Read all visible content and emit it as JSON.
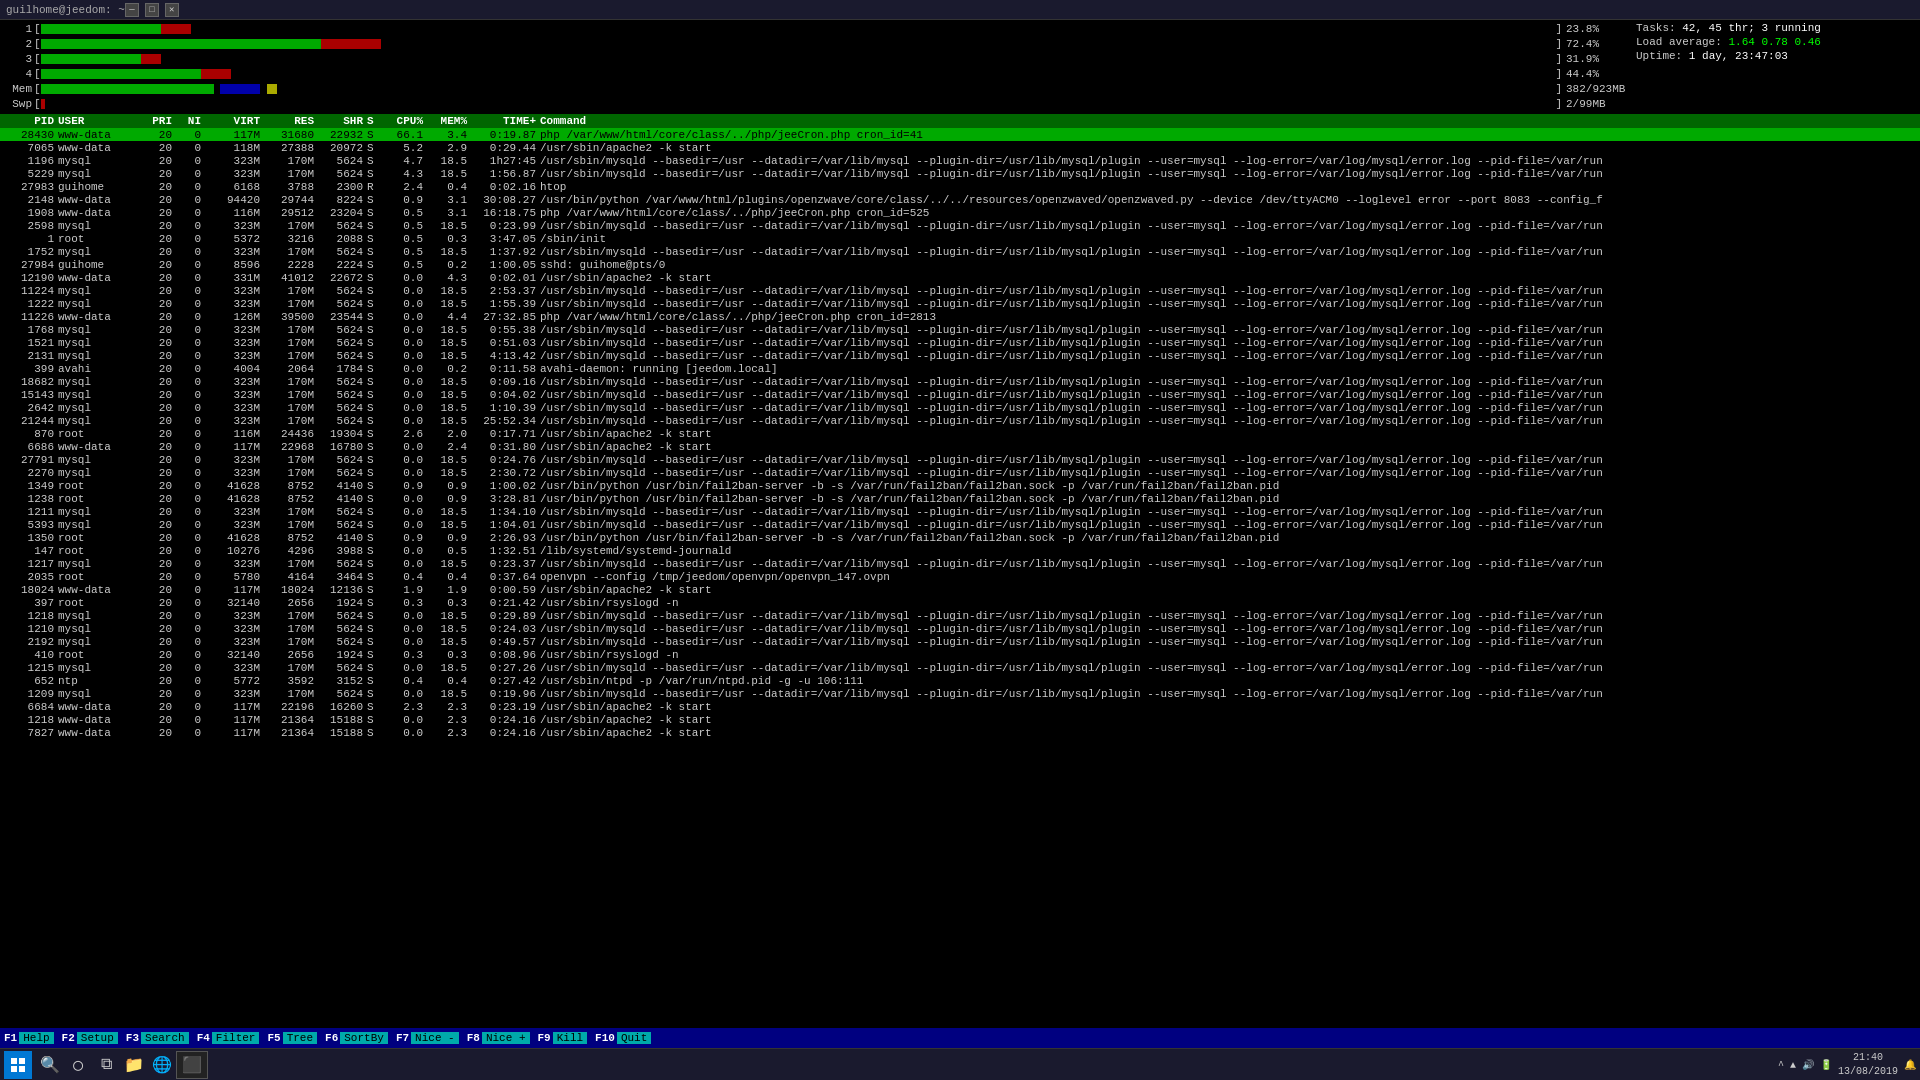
{
  "titlebar": {
    "title": "guilhome@jeedom: ~",
    "controls": [
      "—",
      "□",
      "✕"
    ]
  },
  "cpu_bars": [
    {
      "label": "1",
      "percent": "23.8%",
      "green_w": 120,
      "red_w": 30,
      "total_w": 420
    },
    {
      "label": "2",
      "percent": "72.4%",
      "green_w": 280,
      "red_w": 60,
      "total_w": 420
    },
    {
      "label": "3",
      "percent": "31.9%",
      "green_w": 100,
      "red_w": 20,
      "total_w": 420
    },
    {
      "label": "4",
      "percent": "44.4%",
      "green_w": 160,
      "red_w": 30,
      "total_w": 420
    }
  ],
  "mem_bar": {
    "label": "Mem",
    "used": "382",
    "total": "923MB",
    "display": "382/923MB",
    "green_w": 173,
    "blue_w": 40,
    "yellow_w": 10,
    "total_w": 420
  },
  "swap_bar": {
    "label": "Swp",
    "used": "2",
    "total": "99MB",
    "display": "2/99MB",
    "green_w": 4,
    "total_w": 420
  },
  "sysinfo": {
    "tasks_label": "Tasks:",
    "tasks_val": "42, 45 thr; 3 running",
    "load_label": "Load average:",
    "load_val": "1.64 0.78 0.46",
    "uptime_label": "Uptime:",
    "uptime_val": "1 day, 23:47:03"
  },
  "proc_header": {
    "pid": "PID",
    "user": "USER",
    "pri": "PRI",
    "ni": "NI",
    "virt": "VIRT",
    "res": "RES",
    "shr": "SHR",
    "s": "S",
    "cpu": "CPU%",
    "mem": "MEM%",
    "time": "TIME+",
    "cmd": "Command"
  },
  "processes": [
    {
      "pid": "28430",
      "user": "www-data",
      "pri": "20",
      "ni": "0",
      "virt": "117M",
      "res": "31680",
      "shr": "22932",
      "s": "S",
      "cpu": "66.1",
      "mem": "3.4",
      "time": "0:19.87",
      "cmd": "php /var/www/html/core/class/../php/jeeCron.php cron_id=41",
      "highlight": true
    },
    {
      "pid": "7065",
      "user": "www-data",
      "pri": "20",
      "ni": "0",
      "virt": "118M",
      "res": "27388",
      "shr": "20972",
      "s": "S",
      "cpu": "5.2",
      "mem": "2.9",
      "time": "0:29.44",
      "cmd": "/usr/sbin/apache2 -k start"
    },
    {
      "pid": "1196",
      "user": "mysql",
      "pri": "20",
      "ni": "0",
      "virt": "323M",
      "res": "170M",
      "shr": "5624",
      "s": "S",
      "cpu": "4.7",
      "mem": "18.5",
      "time": "1h27:45",
      "cmd": "/usr/sbin/mysqld --basedir=/usr --datadir=/var/lib/mysql --plugin-dir=/usr/lib/mysql/plugin --user=mysql --log-error=/var/log/mysql/error.log --pid-file=/var/run"
    },
    {
      "pid": "5229",
      "user": "mysql",
      "pri": "20",
      "ni": "0",
      "virt": "323M",
      "res": "170M",
      "shr": "5624",
      "s": "S",
      "cpu": "4.3",
      "mem": "18.5",
      "time": "1:56.87",
      "cmd": "/usr/sbin/mysqld --basedir=/usr --datadir=/var/lib/mysql --plugin-dir=/usr/lib/mysql/plugin --user=mysql --log-error=/var/log/mysql/error.log --pid-file=/var/run"
    },
    {
      "pid": "27983",
      "user": "guihome",
      "pri": "20",
      "ni": "0",
      "virt": "6168",
      "res": "3788",
      "shr": "2300",
      "s": "R",
      "cpu": "2.4",
      "mem": "0.4",
      "time": "0:02.16",
      "cmd": "htop"
    },
    {
      "pid": "2148",
      "user": "www-data",
      "pri": "20",
      "ni": "0",
      "virt": "94420",
      "res": "29744",
      "shr": "8224",
      "s": "S",
      "cpu": "0.9",
      "mem": "3.1",
      "time": "30:08.27",
      "cmd": "/usr/bin/python /var/www/html/plugins/openzwave/core/class/../../resources/openzwaved/openzwaved.py --device /dev/ttyACM0 --loglevel error --port 8083 --config_f"
    },
    {
      "pid": "1908",
      "user": "www-data",
      "pri": "20",
      "ni": "0",
      "virt": "116M",
      "res": "29512",
      "shr": "23204",
      "s": "S",
      "cpu": "0.5",
      "mem": "3.1",
      "time": "16:18.75",
      "cmd": "php /var/www/html/core/class/../php/jeeCron.php cron_id=525"
    },
    {
      "pid": "2598",
      "user": "mysql",
      "pri": "20",
      "ni": "0",
      "virt": "323M",
      "res": "170M",
      "shr": "5624",
      "s": "S",
      "cpu": "0.5",
      "mem": "18.5",
      "time": "0:23.99",
      "cmd": "/usr/sbin/mysqld --basedir=/usr --datadir=/var/lib/mysql --plugin-dir=/usr/lib/mysql/plugin --user=mysql --log-error=/var/log/mysql/error.log --pid-file=/var/run"
    },
    {
      "pid": "1",
      "user": "root",
      "pri": "20",
      "ni": "0",
      "virt": "5372",
      "res": "3216",
      "shr": "2088",
      "s": "S",
      "cpu": "0.5",
      "mem": "0.3",
      "time": "3:47.05",
      "cmd": "/sbin/init"
    },
    {
      "pid": "1752",
      "user": "mysql",
      "pri": "20",
      "ni": "0",
      "virt": "323M",
      "res": "170M",
      "shr": "5624",
      "s": "S",
      "cpu": "0.5",
      "mem": "18.5",
      "time": "1:37.92",
      "cmd": "/usr/sbin/mysqld --basedir=/usr --datadir=/var/lib/mysql --plugin-dir=/usr/lib/mysql/plugin --user=mysql --log-error=/var/log/mysql/error.log --pid-file=/var/run"
    },
    {
      "pid": "27984",
      "user": "guihome",
      "pri": "20",
      "ni": "0",
      "virt": "8596",
      "res": "2228",
      "shr": "2224",
      "s": "S",
      "cpu": "0.5",
      "mem": "0.2",
      "time": "1:00.05",
      "cmd": "sshd: guihome@pts/0"
    },
    {
      "pid": "12190",
      "user": "www-data",
      "pri": "20",
      "ni": "0",
      "virt": "331M",
      "res": "41012",
      "shr": "22672",
      "s": "S",
      "cpu": "0.0",
      "mem": "4.3",
      "time": "0:02.01",
      "cmd": "/usr/sbin/apache2 -k start"
    },
    {
      "pid": "11224",
      "user": "mysql",
      "pri": "20",
      "ni": "0",
      "virt": "323M",
      "res": "170M",
      "shr": "5624",
      "s": "S",
      "cpu": "0.0",
      "mem": "18.5",
      "time": "2:53.37",
      "cmd": "/usr/sbin/mysqld --basedir=/usr --datadir=/var/lib/mysql --plugin-dir=/usr/lib/mysql/plugin --user=mysql --log-error=/var/log/mysql/error.log --pid-file=/var/run"
    },
    {
      "pid": "1222",
      "user": "mysql",
      "pri": "20",
      "ni": "0",
      "virt": "323M",
      "res": "170M",
      "shr": "5624",
      "s": "S",
      "cpu": "0.0",
      "mem": "18.5",
      "time": "1:55.39",
      "cmd": "/usr/sbin/mysqld --basedir=/usr --datadir=/var/lib/mysql --plugin-dir=/usr/lib/mysql/plugin --user=mysql --log-error=/var/log/mysql/error.log --pid-file=/var/run"
    },
    {
      "pid": "11226",
      "user": "www-data",
      "pri": "20",
      "ni": "0",
      "virt": "126M",
      "res": "39500",
      "shr": "23544",
      "s": "S",
      "cpu": "0.0",
      "mem": "4.4",
      "time": "27:32.85",
      "cmd": "php /var/www/html/core/class/../php/jeeCron.php cron_id=2813"
    },
    {
      "pid": "1768",
      "user": "mysql",
      "pri": "20",
      "ni": "0",
      "virt": "323M",
      "res": "170M",
      "shr": "5624",
      "s": "S",
      "cpu": "0.0",
      "mem": "18.5",
      "time": "0:55.38",
      "cmd": "/usr/sbin/mysqld --basedir=/usr --datadir=/var/lib/mysql --plugin-dir=/usr/lib/mysql/plugin --user=mysql --log-error=/var/log/mysql/error.log --pid-file=/var/run"
    },
    {
      "pid": "1521",
      "user": "mysql",
      "pri": "20",
      "ni": "0",
      "virt": "323M",
      "res": "170M",
      "shr": "5624",
      "s": "S",
      "cpu": "0.0",
      "mem": "18.5",
      "time": "0:51.03",
      "cmd": "/usr/sbin/mysqld --basedir=/usr --datadir=/var/lib/mysql --plugin-dir=/usr/lib/mysql/plugin --user=mysql --log-error=/var/log/mysql/error.log --pid-file=/var/run"
    },
    {
      "pid": "2131",
      "user": "mysql",
      "pri": "20",
      "ni": "0",
      "virt": "323M",
      "res": "170M",
      "shr": "5624",
      "s": "S",
      "cpu": "0.0",
      "mem": "18.5",
      "time": "4:13.42",
      "cmd": "/usr/sbin/mysqld --basedir=/usr --datadir=/var/lib/mysql --plugin-dir=/usr/lib/mysql/plugin --user=mysql --log-error=/var/log/mysql/error.log --pid-file=/var/run"
    },
    {
      "pid": "399",
      "user": "avahi",
      "pri": "20",
      "ni": "0",
      "virt": "4004",
      "res": "2064",
      "shr": "1784",
      "s": "S",
      "cpu": "0.0",
      "mem": "0.2",
      "time": "0:11.58",
      "cmd": "avahi-daemon: running [jeedom.local]"
    },
    {
      "pid": "18682",
      "user": "mysql",
      "pri": "20",
      "ni": "0",
      "virt": "323M",
      "res": "170M",
      "shr": "5624",
      "s": "S",
      "cpu": "0.0",
      "mem": "18.5",
      "time": "0:09.16",
      "cmd": "/usr/sbin/mysqld --basedir=/usr --datadir=/var/lib/mysql --plugin-dir=/usr/lib/mysql/plugin --user=mysql --log-error=/var/log/mysql/error.log --pid-file=/var/run"
    },
    {
      "pid": "15143",
      "user": "mysql",
      "pri": "20",
      "ni": "0",
      "virt": "323M",
      "res": "170M",
      "shr": "5624",
      "s": "S",
      "cpu": "0.0",
      "mem": "18.5",
      "time": "0:04.02",
      "cmd": "/usr/sbin/mysqld --basedir=/usr --datadir=/var/lib/mysql --plugin-dir=/usr/lib/mysql/plugin --user=mysql --log-error=/var/log/mysql/error.log --pid-file=/var/run"
    },
    {
      "pid": "2642",
      "user": "mysql",
      "pri": "20",
      "ni": "0",
      "virt": "323M",
      "res": "170M",
      "shr": "5624",
      "s": "S",
      "cpu": "0.0",
      "mem": "18.5",
      "time": "1:10.39",
      "cmd": "/usr/sbin/mysqld --basedir=/usr --datadir=/var/lib/mysql --plugin-dir=/usr/lib/mysql/plugin --user=mysql --log-error=/var/log/mysql/error.log --pid-file=/var/run"
    },
    {
      "pid": "21244",
      "user": "mysql",
      "pri": "20",
      "ni": "0",
      "virt": "323M",
      "res": "170M",
      "shr": "5624",
      "s": "S",
      "cpu": "0.0",
      "mem": "18.5",
      "time": "25:52.34",
      "cmd": "/usr/sbin/mysqld --basedir=/usr --datadir=/var/lib/mysql --plugin-dir=/usr/lib/mysql/plugin --user=mysql --log-error=/var/log/mysql/error.log --pid-file=/var/run"
    },
    {
      "pid": "870",
      "user": "root",
      "pri": "20",
      "ni": "0",
      "virt": "116M",
      "res": "24436",
      "shr": "19304",
      "s": "S",
      "cpu": "2.6",
      "mem": "2.0",
      "time": "0:17.71",
      "cmd": "/usr/sbin/apache2 -k start"
    },
    {
      "pid": "6686",
      "user": "www-data",
      "pri": "20",
      "ni": "0",
      "virt": "117M",
      "res": "22968",
      "shr": "16780",
      "s": "S",
      "cpu": "0.0",
      "mem": "2.4",
      "time": "0:31.80",
      "cmd": "/usr/sbin/apache2 -k start"
    },
    {
      "pid": "27791",
      "user": "mysql",
      "pri": "20",
      "ni": "0",
      "virt": "323M",
      "res": "170M",
      "shr": "5624",
      "s": "S",
      "cpu": "0.0",
      "mem": "18.5",
      "time": "0:24.76",
      "cmd": "/usr/sbin/mysqld --basedir=/usr --datadir=/var/lib/mysql --plugin-dir=/usr/lib/mysql/plugin --user=mysql --log-error=/var/log/mysql/error.log --pid-file=/var/run"
    },
    {
      "pid": "2270",
      "user": "mysql",
      "pri": "20",
      "ni": "0",
      "virt": "323M",
      "res": "170M",
      "shr": "5624",
      "s": "S",
      "cpu": "0.0",
      "mem": "18.5",
      "time": "2:30.72",
      "cmd": "/usr/sbin/mysqld --basedir=/usr --datadir=/var/lib/mysql --plugin-dir=/usr/lib/mysql/plugin --user=mysql --log-error=/var/log/mysql/error.log --pid-file=/var/run"
    },
    {
      "pid": "1349",
      "user": "root",
      "pri": "20",
      "ni": "0",
      "virt": "41628",
      "res": "8752",
      "shr": "4140",
      "s": "S",
      "cpu": "0.9",
      "mem": "0.9",
      "time": "1:00.02",
      "cmd": "/usr/bin/python /usr/bin/fail2ban-server -b -s /var/run/fail2ban/fail2ban.sock -p /var/run/fail2ban/fail2ban.pid"
    },
    {
      "pid": "1238",
      "user": "root",
      "pri": "20",
      "ni": "0",
      "virt": "41628",
      "res": "8752",
      "shr": "4140",
      "s": "S",
      "cpu": "0.0",
      "mem": "0.9",
      "time": "3:28.81",
      "cmd": "/usr/bin/python /usr/bin/fail2ban-server -b -s /var/run/fail2ban/fail2ban.sock -p /var/run/fail2ban/fail2ban.pid"
    },
    {
      "pid": "1211",
      "user": "mysql",
      "pri": "20",
      "ni": "0",
      "virt": "323M",
      "res": "170M",
      "shr": "5624",
      "s": "S",
      "cpu": "0.0",
      "mem": "18.5",
      "time": "1:34.10",
      "cmd": "/usr/sbin/mysqld --basedir=/usr --datadir=/var/lib/mysql --plugin-dir=/usr/lib/mysql/plugin --user=mysql --log-error=/var/log/mysql/error.log --pid-file=/var/run"
    },
    {
      "pid": "5393",
      "user": "mysql",
      "pri": "20",
      "ni": "0",
      "virt": "323M",
      "res": "170M",
      "shr": "5624",
      "s": "S",
      "cpu": "0.0",
      "mem": "18.5",
      "time": "1:04.01",
      "cmd": "/usr/sbin/mysqld --basedir=/usr --datadir=/var/lib/mysql --plugin-dir=/usr/lib/mysql/plugin --user=mysql --log-error=/var/log/mysql/error.log --pid-file=/var/run"
    },
    {
      "pid": "1350",
      "user": "root",
      "pri": "20",
      "ni": "0",
      "virt": "41628",
      "res": "8752",
      "shr": "4140",
      "s": "S",
      "cpu": "0.9",
      "mem": "0.9",
      "time": "2:26.93",
      "cmd": "/usr/bin/python /usr/bin/fail2ban-server -b -s /var/run/fail2ban/fail2ban.sock -p /var/run/fail2ban/fail2ban.pid"
    },
    {
      "pid": "147",
      "user": "root",
      "pri": "20",
      "ni": "0",
      "virt": "10276",
      "res": "4296",
      "shr": "3988",
      "s": "S",
      "cpu": "0.0",
      "mem": "0.5",
      "time": "1:32.51",
      "cmd": "/lib/systemd/systemd-journald"
    },
    {
      "pid": "1217",
      "user": "mysql",
      "pri": "20",
      "ni": "0",
      "virt": "323M",
      "res": "170M",
      "shr": "5624",
      "s": "S",
      "cpu": "0.0",
      "mem": "18.5",
      "time": "0:23.37",
      "cmd": "/usr/sbin/mysqld --basedir=/usr --datadir=/var/lib/mysql --plugin-dir=/usr/lib/mysql/plugin --user=mysql --log-error=/var/log/mysql/error.log --pid-file=/var/run"
    },
    {
      "pid": "2035",
      "user": "root",
      "pri": "20",
      "ni": "0",
      "virt": "5780",
      "res": "4164",
      "shr": "3464",
      "s": "S",
      "cpu": "0.4",
      "mem": "0.4",
      "time": "0:37.64",
      "cmd": "openvpn --config /tmp/jeedom/openvpn/openvpn_147.ovpn"
    },
    {
      "pid": "18024",
      "user": "www-data",
      "pri": "20",
      "ni": "0",
      "virt": "117M",
      "res": "18024",
      "shr": "12136",
      "s": "S",
      "cpu": "1.9",
      "mem": "1.9",
      "time": "0:00.59",
      "cmd": "/usr/sbin/apache2 -k start"
    },
    {
      "pid": "397",
      "user": "root",
      "pri": "20",
      "ni": "0",
      "virt": "32140",
      "res": "2656",
      "shr": "1924",
      "s": "S",
      "cpu": "0.3",
      "mem": "0.3",
      "time": "0:21.42",
      "cmd": "/usr/sbin/rsyslogd -n"
    },
    {
      "pid": "1218",
      "user": "mysql",
      "pri": "20",
      "ni": "0",
      "virt": "323M",
      "res": "170M",
      "shr": "5624",
      "s": "S",
      "cpu": "0.0",
      "mem": "18.5",
      "time": "0:29.89",
      "cmd": "/usr/sbin/mysqld --basedir=/usr --datadir=/var/lib/mysql --plugin-dir=/usr/lib/mysql/plugin --user=mysql --log-error=/var/log/mysql/error.log --pid-file=/var/run"
    },
    {
      "pid": "1210",
      "user": "mysql",
      "pri": "20",
      "ni": "0",
      "virt": "323M",
      "res": "170M",
      "shr": "5624",
      "s": "S",
      "cpu": "0.0",
      "mem": "18.5",
      "time": "0:24.03",
      "cmd": "/usr/sbin/mysqld --basedir=/usr --datadir=/var/lib/mysql --plugin-dir=/usr/lib/mysql/plugin --user=mysql --log-error=/var/log/mysql/error.log --pid-file=/var/run"
    },
    {
      "pid": "2192",
      "user": "mysql",
      "pri": "20",
      "ni": "0",
      "virt": "323M",
      "res": "170M",
      "shr": "5624",
      "s": "S",
      "cpu": "0.0",
      "mem": "18.5",
      "time": "0:49.57",
      "cmd": "/usr/sbin/mysqld --basedir=/usr --datadir=/var/lib/mysql --plugin-dir=/usr/lib/mysql/plugin --user=mysql --log-error=/var/log/mysql/error.log --pid-file=/var/run"
    },
    {
      "pid": "410",
      "user": "root",
      "pri": "20",
      "ni": "0",
      "virt": "32140",
      "res": "2656",
      "shr": "1924",
      "s": "S",
      "cpu": "0.3",
      "mem": "0.3",
      "time": "0:08.96",
      "cmd": "/usr/sbin/rsyslogd -n"
    },
    {
      "pid": "1215",
      "user": "mysql",
      "pri": "20",
      "ni": "0",
      "virt": "323M",
      "res": "170M",
      "shr": "5624",
      "s": "S",
      "cpu": "0.0",
      "mem": "18.5",
      "time": "0:27.26",
      "cmd": "/usr/sbin/mysqld --basedir=/usr --datadir=/var/lib/mysql --plugin-dir=/usr/lib/mysql/plugin --user=mysql --log-error=/var/log/mysql/error.log --pid-file=/var/run"
    },
    {
      "pid": "652",
      "user": "ntp",
      "pri": "20",
      "ni": "0",
      "virt": "5772",
      "res": "3592",
      "shr": "3152",
      "s": "S",
      "cpu": "0.4",
      "mem": "0.4",
      "time": "0:27.42",
      "cmd": "/usr/sbin/ntpd -p /var/run/ntpd.pid -g -u 106:111"
    },
    {
      "pid": "1209",
      "user": "mysql",
      "pri": "20",
      "ni": "0",
      "virt": "323M",
      "res": "170M",
      "shr": "5624",
      "s": "S",
      "cpu": "0.0",
      "mem": "18.5",
      "time": "0:19.96",
      "cmd": "/usr/sbin/mysqld --basedir=/usr --datadir=/var/lib/mysql --plugin-dir=/usr/lib/mysql/plugin --user=mysql --log-error=/var/log/mysql/error.log --pid-file=/var/run"
    },
    {
      "pid": "6684",
      "user": "www-data",
      "pri": "20",
      "ni": "0",
      "virt": "117M",
      "res": "22196",
      "shr": "16260",
      "s": "S",
      "cpu": "2.3",
      "mem": "2.3",
      "time": "0:23.19",
      "cmd": "/usr/sbin/apache2 -k start"
    },
    {
      "pid": "1218",
      "user": "www-data",
      "pri": "20",
      "ni": "0",
      "virt": "117M",
      "res": "21364",
      "shr": "15188",
      "s": "S",
      "cpu": "0.0",
      "mem": "2.3",
      "time": "0:24.16",
      "cmd": "/usr/sbin/apache2 -k start"
    },
    {
      "pid": "7827",
      "user": "www-data",
      "pri": "20",
      "ni": "0",
      "virt": "117M",
      "res": "21364",
      "shr": "15188",
      "s": "S",
      "cpu": "0.0",
      "mem": "2.3",
      "time": "0:24.16",
      "cmd": "/usr/sbin/apache2 -k start"
    }
  ],
  "fn_keys": [
    {
      "num": "F1",
      "label": "Help"
    },
    {
      "num": "F2",
      "label": "Setup"
    },
    {
      "num": "F3",
      "label": "Search"
    },
    {
      "num": "F4",
      "label": "Filter"
    },
    {
      "num": "F5",
      "label": "Tree"
    },
    {
      "num": "F6",
      "label": "SortBy"
    },
    {
      "num": "F7",
      "label": "Nice -"
    },
    {
      "num": "F8",
      "label": "Nice +"
    },
    {
      "num": "F9",
      "label": "Kill"
    },
    {
      "num": "F10",
      "label": "Quit"
    }
  ],
  "taskbar": {
    "time": "21:40",
    "date": "13/08/2019"
  }
}
